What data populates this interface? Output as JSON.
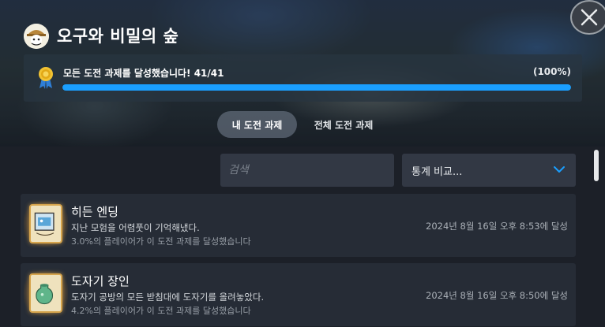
{
  "window": {
    "close_icon": "close-icon"
  },
  "game": {
    "title": "오구와 비밀의 숲",
    "icon": "game-logo-icon"
  },
  "progress": {
    "message": "모든 도전 과제를 달성했습니다! 41/41",
    "percent_label": "(100%)",
    "achieved": 41,
    "total": 41,
    "fraction": 1.0,
    "icon": "medal-icon",
    "bar_color": "#1a9fff"
  },
  "tabs": [
    {
      "label": "내 도전 과제",
      "active": true
    },
    {
      "label": "전체 도전 과제",
      "active": false
    }
  ],
  "filters": {
    "search_placeholder": "검색",
    "search_value": "",
    "compare_label": "통계 비교..."
  },
  "achievements": [
    {
      "name": "히든 엔딩",
      "description": "지난 모험을 어렴풋이 기억해냈다.",
      "rate": "3.0%의 플레이어가 이 도전 과제를 달성했습니다",
      "date": "2024년 8월 16일 오후 8:53에 달성",
      "icon": "photo-frame-icon"
    },
    {
      "name": "도자기 장인",
      "description": "도자기 공방의 모든 받침대에 도자기를 올려놓았다.",
      "rate": "4.2%의 플레이어가 이 도전 과제를 달성했습니다",
      "date": "2024년 8월 16일 오후 8:50에 달성",
      "icon": "pottery-icon"
    }
  ]
}
